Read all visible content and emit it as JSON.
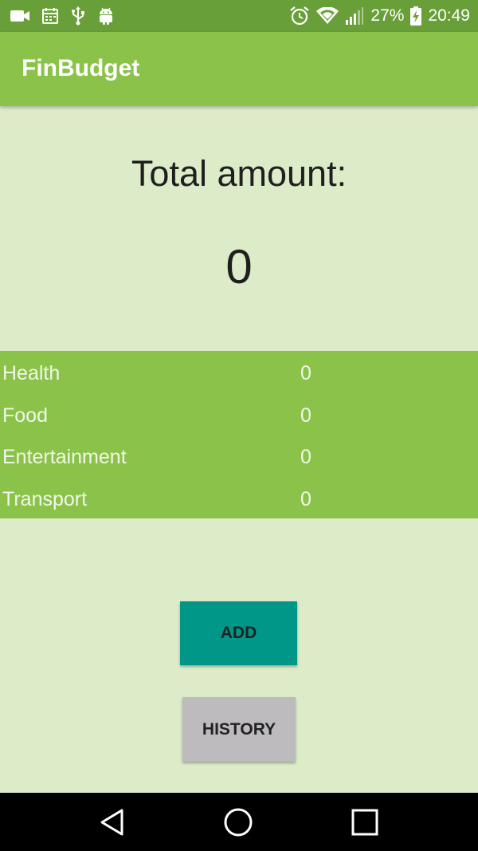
{
  "status_bar": {
    "battery_percent": "27%",
    "time": "20:49",
    "icons_left": [
      "video-camera-icon",
      "calendar-icon",
      "usb-icon",
      "android-icon"
    ],
    "icons_right": [
      "alarm-icon",
      "wifi-icon",
      "signal-icon",
      "battery-charging-icon"
    ]
  },
  "app_bar": {
    "title": "FinBudget"
  },
  "total": {
    "label": "Total amount:",
    "value": "0"
  },
  "categories": [
    {
      "name": "Health",
      "value": "0"
    },
    {
      "name": "Food",
      "value": "0"
    },
    {
      "name": "Entertainment",
      "value": "0"
    },
    {
      "name": "Transport",
      "value": "0"
    }
  ],
  "buttons": {
    "add_label": "ADD",
    "history_label": "HISTORY"
  },
  "nav_bar": {
    "icons": [
      "back-icon",
      "home-icon",
      "recents-icon"
    ]
  },
  "colors": {
    "status_bar": "#689f38",
    "app_bar": "#8bc34a",
    "background": "#dcebc8",
    "add_button": "#009688",
    "history_button": "#bdbbbe"
  }
}
